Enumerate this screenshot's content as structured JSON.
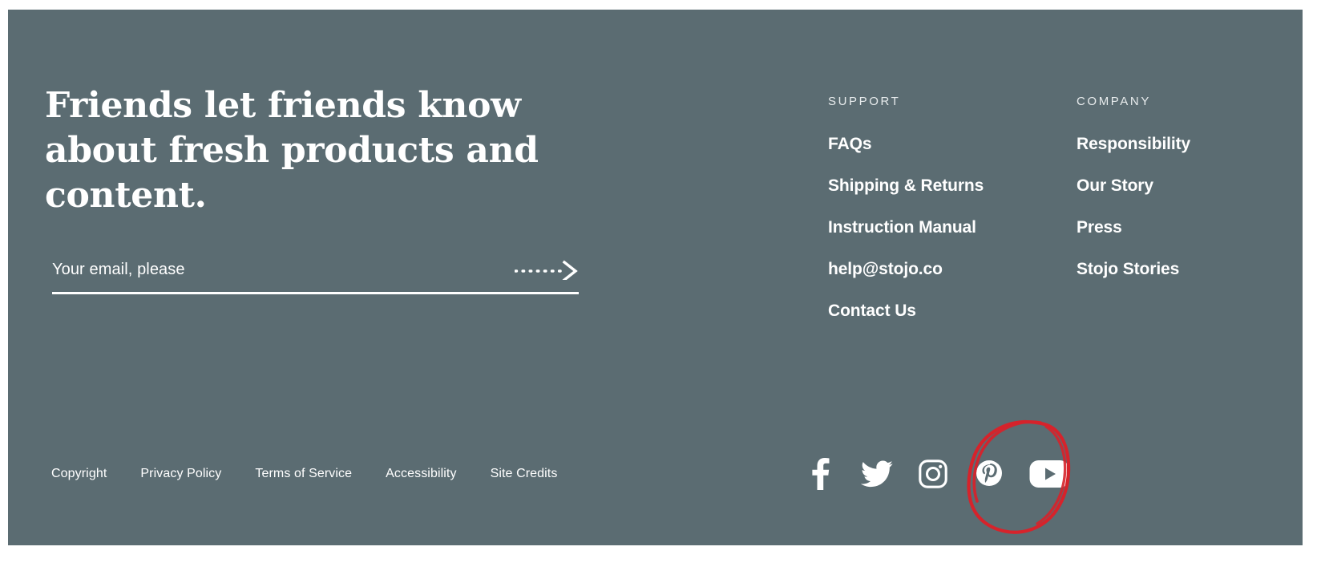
{
  "footer": {
    "background_color": "#5b6c72",
    "newsletter": {
      "heading": "Friends let friends know about fresh products and content.",
      "email_value": "",
      "email_placeholder": "Your email, please",
      "submit_icon": "dotted-arrow-right-icon"
    },
    "link_columns": [
      {
        "heading": "SUPPORT",
        "links": [
          "FAQs",
          "Shipping & Returns",
          "Instruction Manual",
          "help@stojo.co",
          "Contact Us"
        ]
      },
      {
        "heading": "COMPANY",
        "links": [
          "Responsibility",
          "Our Story",
          "Press",
          "Stojo Stories"
        ]
      }
    ],
    "legal_links": [
      "Copyright",
      "Privacy Policy",
      "Terms of Service",
      "Accessibility",
      "Site Credits"
    ],
    "social_links": [
      {
        "name": "Facebook",
        "icon": "facebook-icon"
      },
      {
        "name": "Twitter",
        "icon": "twitter-icon"
      },
      {
        "name": "Instagram",
        "icon": "instagram-icon"
      },
      {
        "name": "Pinterest",
        "icon": "pinterest-icon"
      },
      {
        "name": "YouTube",
        "icon": "youtube-icon"
      }
    ]
  },
  "annotation": {
    "shape": "hand-drawn-ellipse",
    "color": "#d6232b",
    "targets": "youtube-icon"
  }
}
